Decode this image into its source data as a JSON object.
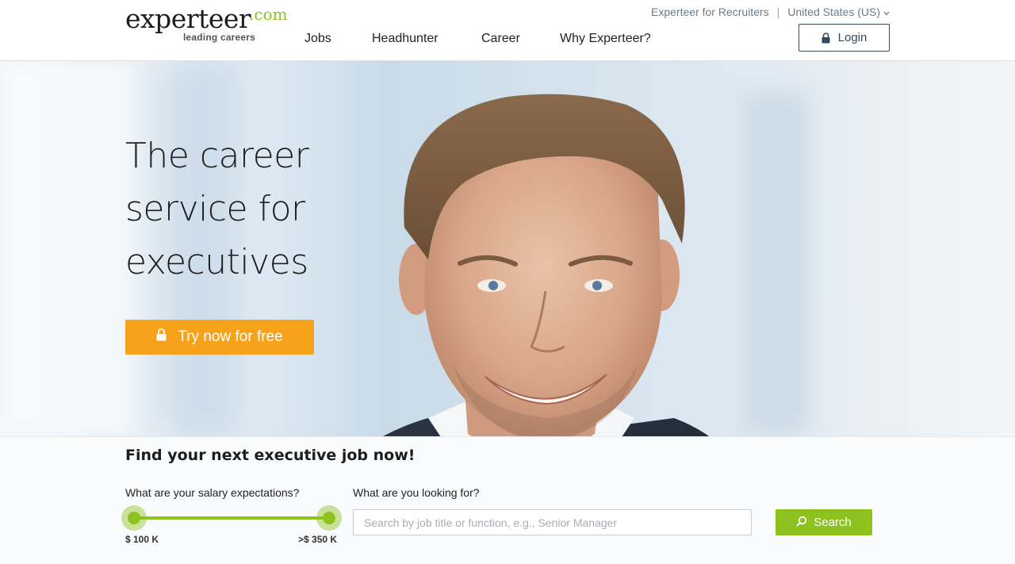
{
  "brand": {
    "name": "experteer",
    "suffix": ".com",
    "tagline": "leading careers",
    "accent_color": "#8dc21f",
    "cta_color": "#f7a21b"
  },
  "nav": {
    "items": [
      {
        "label": "Jobs"
      },
      {
        "label": "Headhunter"
      },
      {
        "label": "Career"
      },
      {
        "label": "Why Experteer?"
      }
    ]
  },
  "utility": {
    "recruiters_link": "Experteer for Recruiters",
    "separator": "|",
    "region": "United States (US)",
    "region_icon": "chevron-down-icon"
  },
  "login": {
    "label": "Login",
    "icon": "lock-icon"
  },
  "hero": {
    "headline_lines": [
      "The career",
      "service for",
      "executives"
    ],
    "cta_label": "Try now for free",
    "cta_icon": "lock-icon"
  },
  "search": {
    "title": "Find your next executive job now!",
    "salary_label": "What are your salary expectations?",
    "salary_min": "$ 100 K",
    "salary_max": ">$ 350 K",
    "query_label": "What are you looking for?",
    "query_value": "",
    "query_placeholder": "Search by job title or function, e.g., Senior Manager",
    "button_label": "Search",
    "button_icon": "search-icon"
  }
}
